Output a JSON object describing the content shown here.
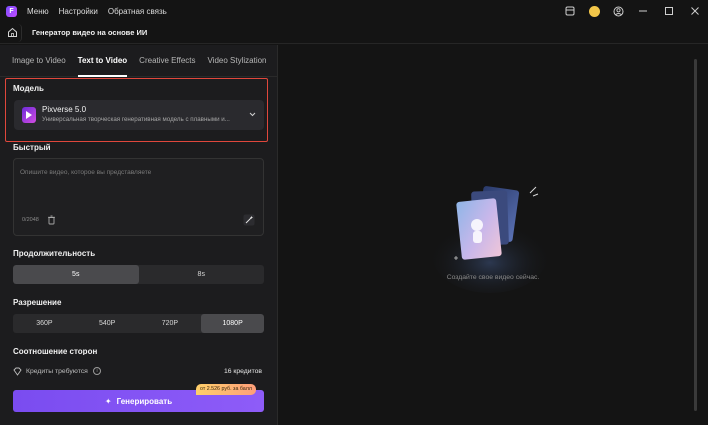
{
  "titlebar": {
    "menu": [
      "Меню",
      "Настройки",
      "Обратная связь"
    ]
  },
  "header": {
    "title": "Генератор видео на основе ИИ"
  },
  "tabs": [
    "Image to Video",
    "Text to Video",
    "Creative Effects",
    "Video Stylization"
  ],
  "model": {
    "label": "Модель",
    "name": "Pixverse 5.0",
    "description": "Универсальная творческая генеративная модель с плавными и..."
  },
  "prompt": {
    "label": "Быстрый",
    "placeholder": "Опишите видео, которое вы представляете",
    "count": "0/2048"
  },
  "duration": {
    "label": "Продолжительность",
    "options": [
      "5s",
      "8s"
    ],
    "selected": "5s"
  },
  "resolution": {
    "label": "Разрешение",
    "options": [
      "360P",
      "540P",
      "720P",
      "1080P"
    ],
    "selected": "1080P"
  },
  "aspect": {
    "label": "Соотношение сторон"
  },
  "credits": {
    "label": "Кредиты требуются",
    "value": "16 кредитов"
  },
  "generate": {
    "label": "Генерировать",
    "promo": "от 2.526 руб. за балл"
  },
  "empty_state": {
    "text": "Создайте свое видео сейчас."
  },
  "colors": {
    "accent": "#7a4cf0",
    "highlight_border": "#e0473c",
    "promo": "#ffcf6a"
  }
}
